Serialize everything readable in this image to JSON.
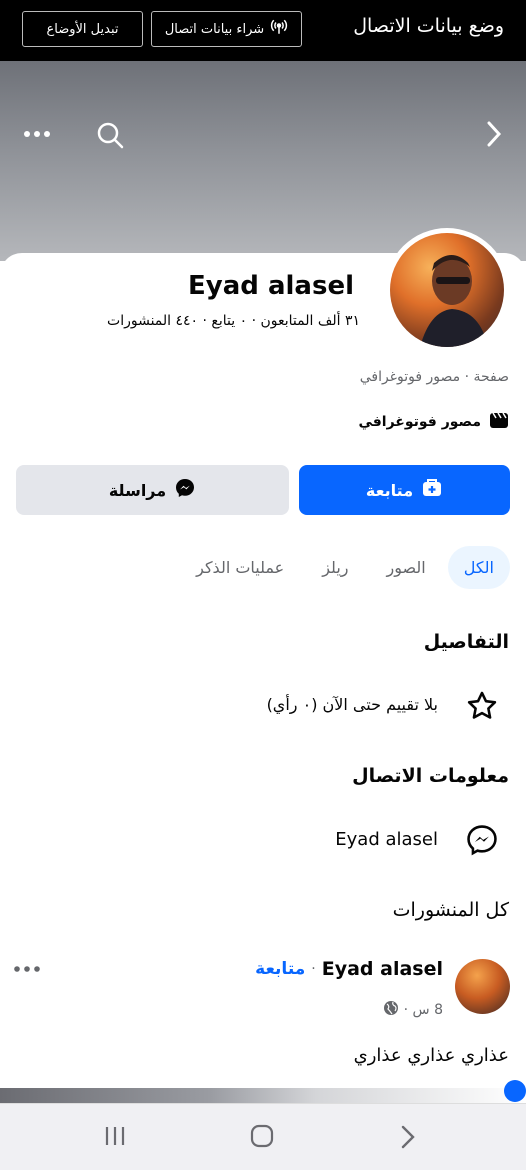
{
  "topbar": {
    "title": "وضع بيانات الاتصال",
    "buy_label": "شراء بيانات اتصال",
    "switch_label": "تبديل الأوضاع"
  },
  "profile": {
    "name": "Eyad alasel",
    "stats": "٣١ ألف المتابعون · ٠ يتابع · ٤٤٠ المنشورات",
    "category": "صفحة · مصور فوتوغرافي",
    "job": "مصور فوتوغرافي"
  },
  "actions": {
    "follow": "متابعة",
    "message": "مراسلة"
  },
  "tabs": [
    "الكل",
    "الصور",
    "ريلز",
    "عمليات الذكر"
  ],
  "details": {
    "heading": "التفاصيل",
    "rating": "بلا تقييم حتى الآن (٠ رأي)"
  },
  "contact": {
    "heading": "معلومات الاتصال",
    "messenger_name": "Eyad alasel"
  },
  "posts": {
    "heading": "كل المنشورات",
    "author": "Eyad alasel",
    "follow_link": "متابعة",
    "separator": "·",
    "time": "8 س ·",
    "text": "عذاري عذاري عذاري"
  },
  "colors": {
    "accent": "#0866ff",
    "topbar": "#000000",
    "secondary_btn": "#e4e6eb"
  },
  "icons": [
    "chevron-right-icon",
    "search-icon",
    "more-icon",
    "add-friend-icon",
    "messenger-icon",
    "star-icon",
    "globe-icon",
    "clapperboard-icon",
    "broadcast-icon"
  ]
}
